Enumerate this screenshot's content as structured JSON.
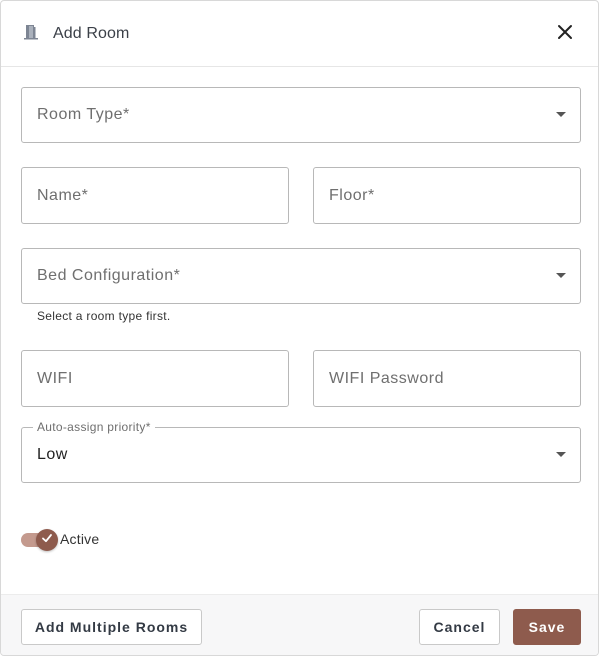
{
  "dialog": {
    "title": "Add Room",
    "icon": "door-icon",
    "close_icon": "close-icon"
  },
  "form": {
    "room_type": {
      "placeholder": "Room Type*",
      "value": ""
    },
    "name": {
      "placeholder": "Name*",
      "value": ""
    },
    "floor": {
      "placeholder": "Floor*",
      "value": ""
    },
    "bed_configuration": {
      "placeholder": "Bed Configuration*",
      "value": "",
      "helper": "Select a room type first."
    },
    "wifi": {
      "placeholder": "WIFI",
      "value": ""
    },
    "wifi_password": {
      "placeholder": "WIFI Password",
      "value": ""
    },
    "auto_assign_priority": {
      "label": "Auto-assign priority*",
      "value": "Low"
    },
    "active": {
      "label": "Active",
      "checked": true
    }
  },
  "footer": {
    "add_multiple_label": "Add Multiple Rooms",
    "cancel_label": "Cancel",
    "save_label": "Save"
  },
  "colors": {
    "accent": "#8e5b4d",
    "toggle_track": "#c49a8e",
    "border": "#b8b8b8"
  }
}
